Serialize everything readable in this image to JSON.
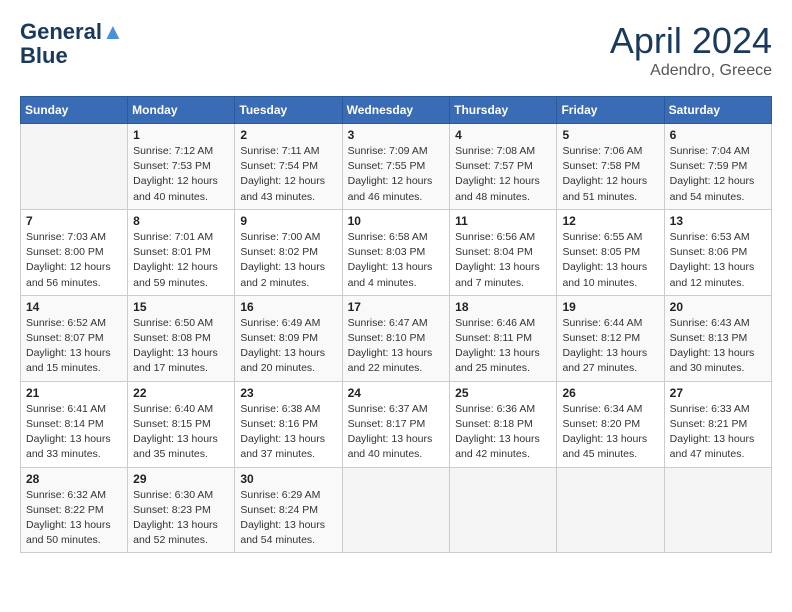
{
  "header": {
    "logo_line1": "General",
    "logo_line2": "Blue",
    "month": "April 2024",
    "location": "Adendro, Greece"
  },
  "weekdays": [
    "Sunday",
    "Monday",
    "Tuesday",
    "Wednesday",
    "Thursday",
    "Friday",
    "Saturday"
  ],
  "weeks": [
    [
      {
        "day": "",
        "info": ""
      },
      {
        "day": "1",
        "info": "Sunrise: 7:12 AM\nSunset: 7:53 PM\nDaylight: 12 hours\nand 40 minutes."
      },
      {
        "day": "2",
        "info": "Sunrise: 7:11 AM\nSunset: 7:54 PM\nDaylight: 12 hours\nand 43 minutes."
      },
      {
        "day": "3",
        "info": "Sunrise: 7:09 AM\nSunset: 7:55 PM\nDaylight: 12 hours\nand 46 minutes."
      },
      {
        "day": "4",
        "info": "Sunrise: 7:08 AM\nSunset: 7:57 PM\nDaylight: 12 hours\nand 48 minutes."
      },
      {
        "day": "5",
        "info": "Sunrise: 7:06 AM\nSunset: 7:58 PM\nDaylight: 12 hours\nand 51 minutes."
      },
      {
        "day": "6",
        "info": "Sunrise: 7:04 AM\nSunset: 7:59 PM\nDaylight: 12 hours\nand 54 minutes."
      }
    ],
    [
      {
        "day": "7",
        "info": "Sunrise: 7:03 AM\nSunset: 8:00 PM\nDaylight: 12 hours\nand 56 minutes."
      },
      {
        "day": "8",
        "info": "Sunrise: 7:01 AM\nSunset: 8:01 PM\nDaylight: 12 hours\nand 59 minutes."
      },
      {
        "day": "9",
        "info": "Sunrise: 7:00 AM\nSunset: 8:02 PM\nDaylight: 13 hours\nand 2 minutes."
      },
      {
        "day": "10",
        "info": "Sunrise: 6:58 AM\nSunset: 8:03 PM\nDaylight: 13 hours\nand 4 minutes."
      },
      {
        "day": "11",
        "info": "Sunrise: 6:56 AM\nSunset: 8:04 PM\nDaylight: 13 hours\nand 7 minutes."
      },
      {
        "day": "12",
        "info": "Sunrise: 6:55 AM\nSunset: 8:05 PM\nDaylight: 13 hours\nand 10 minutes."
      },
      {
        "day": "13",
        "info": "Sunrise: 6:53 AM\nSunset: 8:06 PM\nDaylight: 13 hours\nand 12 minutes."
      }
    ],
    [
      {
        "day": "14",
        "info": "Sunrise: 6:52 AM\nSunset: 8:07 PM\nDaylight: 13 hours\nand 15 minutes."
      },
      {
        "day": "15",
        "info": "Sunrise: 6:50 AM\nSunset: 8:08 PM\nDaylight: 13 hours\nand 17 minutes."
      },
      {
        "day": "16",
        "info": "Sunrise: 6:49 AM\nSunset: 8:09 PM\nDaylight: 13 hours\nand 20 minutes."
      },
      {
        "day": "17",
        "info": "Sunrise: 6:47 AM\nSunset: 8:10 PM\nDaylight: 13 hours\nand 22 minutes."
      },
      {
        "day": "18",
        "info": "Sunrise: 6:46 AM\nSunset: 8:11 PM\nDaylight: 13 hours\nand 25 minutes."
      },
      {
        "day": "19",
        "info": "Sunrise: 6:44 AM\nSunset: 8:12 PM\nDaylight: 13 hours\nand 27 minutes."
      },
      {
        "day": "20",
        "info": "Sunrise: 6:43 AM\nSunset: 8:13 PM\nDaylight: 13 hours\nand 30 minutes."
      }
    ],
    [
      {
        "day": "21",
        "info": "Sunrise: 6:41 AM\nSunset: 8:14 PM\nDaylight: 13 hours\nand 33 minutes."
      },
      {
        "day": "22",
        "info": "Sunrise: 6:40 AM\nSunset: 8:15 PM\nDaylight: 13 hours\nand 35 minutes."
      },
      {
        "day": "23",
        "info": "Sunrise: 6:38 AM\nSunset: 8:16 PM\nDaylight: 13 hours\nand 37 minutes."
      },
      {
        "day": "24",
        "info": "Sunrise: 6:37 AM\nSunset: 8:17 PM\nDaylight: 13 hours\nand 40 minutes."
      },
      {
        "day": "25",
        "info": "Sunrise: 6:36 AM\nSunset: 8:18 PM\nDaylight: 13 hours\nand 42 minutes."
      },
      {
        "day": "26",
        "info": "Sunrise: 6:34 AM\nSunset: 8:20 PM\nDaylight: 13 hours\nand 45 minutes."
      },
      {
        "day": "27",
        "info": "Sunrise: 6:33 AM\nSunset: 8:21 PM\nDaylight: 13 hours\nand 47 minutes."
      }
    ],
    [
      {
        "day": "28",
        "info": "Sunrise: 6:32 AM\nSunset: 8:22 PM\nDaylight: 13 hours\nand 50 minutes."
      },
      {
        "day": "29",
        "info": "Sunrise: 6:30 AM\nSunset: 8:23 PM\nDaylight: 13 hours\nand 52 minutes."
      },
      {
        "day": "30",
        "info": "Sunrise: 6:29 AM\nSunset: 8:24 PM\nDaylight: 13 hours\nand 54 minutes."
      },
      {
        "day": "",
        "info": ""
      },
      {
        "day": "",
        "info": ""
      },
      {
        "day": "",
        "info": ""
      },
      {
        "day": "",
        "info": ""
      }
    ]
  ]
}
